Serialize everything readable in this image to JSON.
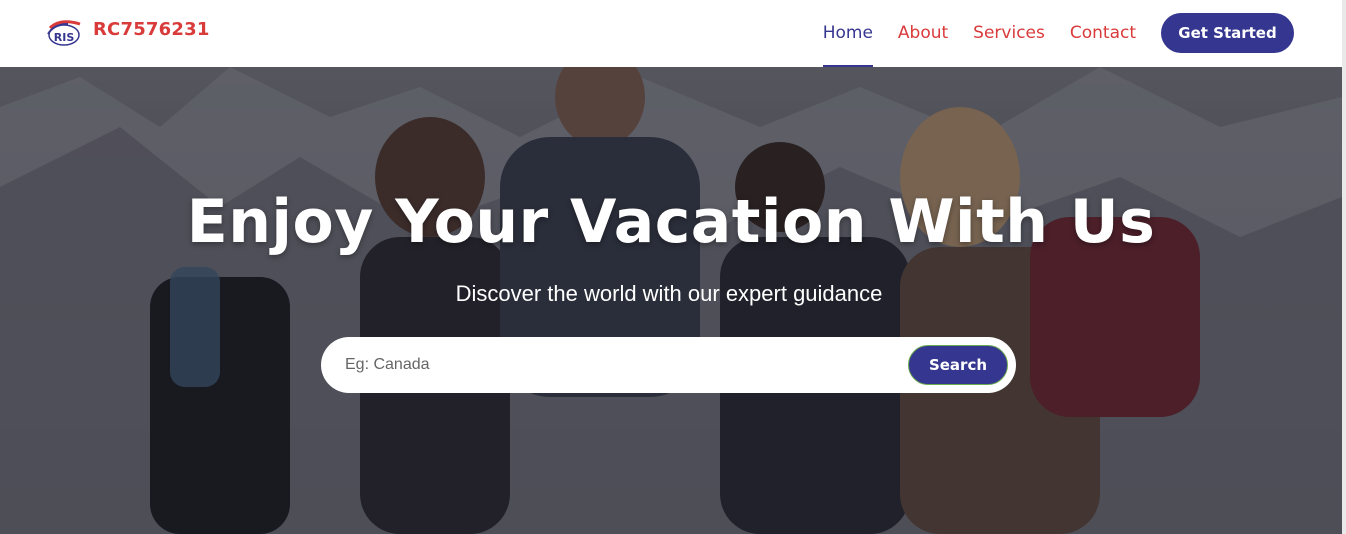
{
  "brand": {
    "logo_text": "RIS",
    "name": "RC7576231"
  },
  "nav": {
    "items": [
      {
        "label": "Home",
        "active": true
      },
      {
        "label": "About",
        "active": false
      },
      {
        "label": "Services",
        "active": false
      },
      {
        "label": "Contact",
        "active": false
      }
    ],
    "cta_label": "Get Started"
  },
  "hero": {
    "title": "Enjoy Your Vacation With Us",
    "subtitle": "Discover the world with our expert guidance",
    "background_image": "group-of-hikers-photo"
  },
  "search": {
    "placeholder": "Eg: Canada",
    "value": "",
    "button_label": "Search"
  },
  "colors": {
    "brand_red": "#d93a3a",
    "primary_navy": "#35368f",
    "white": "#ffffff"
  }
}
